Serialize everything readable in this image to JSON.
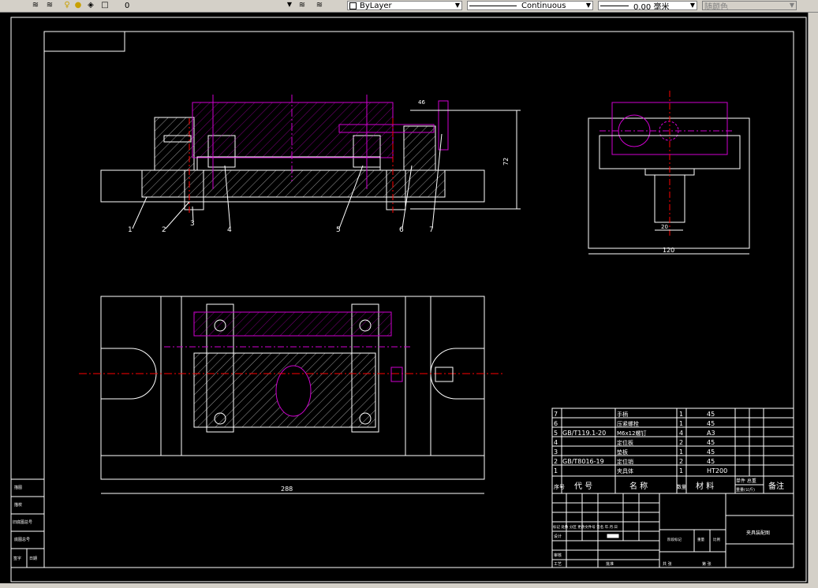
{
  "toolbar": {
    "layer_value": "0",
    "color_value": "ByLayer",
    "linetype_value": "Continuous",
    "lineweight_value": "0.00 毫米",
    "plotstyle_value": "随颜色"
  },
  "drawing": {
    "part_labels": [
      "1",
      "2",
      "3",
      "4",
      "5",
      "6",
      "7"
    ],
    "dim_height": "72",
    "dim_width_side": "120",
    "dim_small": "20",
    "dim_small2": "46",
    "dim_length": "288"
  },
  "bom": {
    "rows": [
      {
        "no": "7",
        "code": "",
        "name": "手柄",
        "qty": "1",
        "material": "45"
      },
      {
        "no": "6",
        "code": "",
        "name": "压紧螺栓",
        "qty": "1",
        "material": "45"
      },
      {
        "no": "5",
        "code": "GB/T119.1-20",
        "name": "M6x12螺钉",
        "qty": "4",
        "material": "A3"
      },
      {
        "no": "4",
        "code": "",
        "name": "定位板",
        "qty": "2",
        "material": "45"
      },
      {
        "no": "3",
        "code": "",
        "name": "垫板",
        "qty": "1",
        "material": "45"
      },
      {
        "no": "2",
        "code": "GB/T8016-19",
        "name": "定位销",
        "qty": "2",
        "material": "45"
      },
      {
        "no": "1",
        "code": "",
        "name": "夹具体",
        "qty": "1",
        "material": "HT200"
      }
    ],
    "header": {
      "no": "序号",
      "code": "代 号",
      "name": "名 称",
      "qty": "数量",
      "material": "材 料",
      "weight_top": "单件 总重",
      "weight_bot": "重量(公斤)",
      "remark": "备注"
    }
  },
  "title_block": {
    "drawing_name": "夹具装配图",
    "mark_cols": "标记 处数 分区 更改文件号 签名 年.月.日",
    "design": "设计",
    "check": "审核",
    "process": "工艺",
    "approve": "批准",
    "stage": "阶段标记",
    "weight": "重量",
    "scale": "比例",
    "sheet_total": "共 张",
    "sheet_no": "第 张"
  },
  "side_block": [
    "描图",
    "描校",
    "旧底图总号",
    "底图总号",
    "签字",
    "日期"
  ]
}
